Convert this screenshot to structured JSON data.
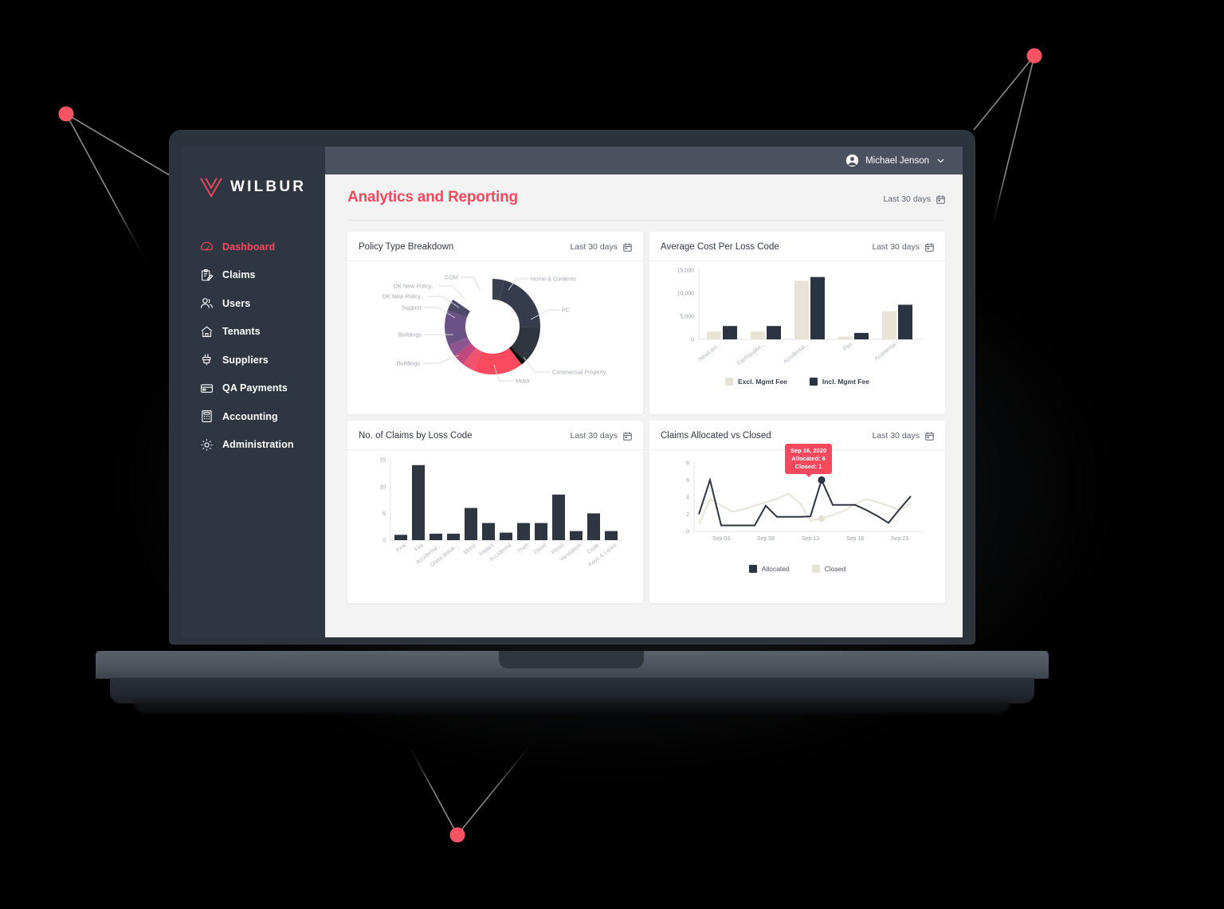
{
  "brand": {
    "name": "WILBUR",
    "logo_icon": "wilbur-logo-icon",
    "accent": "#f8485e"
  },
  "topbar": {
    "user_name": "Michael Jenson",
    "avatar_icon": "user-avatar-icon",
    "chevron_icon": "chevron-down-icon"
  },
  "sidebar": {
    "items": [
      {
        "label": "Dashboard",
        "icon": "gauge-icon",
        "active": true
      },
      {
        "label": "Claims",
        "icon": "clipboard-pen-icon",
        "active": false
      },
      {
        "label": "Users",
        "icon": "users-icon",
        "active": false
      },
      {
        "label": "Tenants",
        "icon": "home-icon",
        "active": false
      },
      {
        "label": "Suppliers",
        "icon": "paint-brush-icon",
        "active": false
      },
      {
        "label": "QA Payments",
        "icon": "credit-card-icon",
        "active": false
      },
      {
        "label": "Accounting",
        "icon": "calculator-icon",
        "active": false
      },
      {
        "label": "Administration",
        "icon": "gear-icon",
        "active": false
      }
    ]
  },
  "page": {
    "title": "Analytics and Reporting",
    "range_label": "Last 30 days",
    "calendar_icon": "calendar-icon"
  },
  "cards": {
    "policy_type": {
      "title": "Policy Type Breakdown",
      "range_label": "Last 30 days",
      "calendar_icon": "calendar-icon"
    },
    "avg_cost": {
      "title": "Average Cost Per Loss Code",
      "range_label": "Last 30 days",
      "calendar_icon": "calendar-icon"
    },
    "claims_count": {
      "title": "No. of Claims by Loss Code",
      "range_label": "Last 30 days",
      "calendar_icon": "calendar-icon"
    },
    "alloc_closed": {
      "title": "Claims Allocated vs Closed",
      "range_label": "Last 30 days",
      "calendar_icon": "calendar-icon"
    }
  },
  "chart_data": [
    {
      "id": "policy_type_breakdown",
      "type": "pie",
      "title": "Policy Type Breakdown",
      "donut": true,
      "legend_position": "outside-labels",
      "labels": [
        "Home & Contents",
        "PC",
        "Commercial Property",
        "Motor",
        "Buildings",
        "Buildings",
        "Support",
        "OK New Policy...",
        "OK New Policy...",
        "COM"
      ],
      "values": [
        4,
        21,
        13,
        1.5,
        17,
        4,
        4,
        4,
        12,
        4
      ],
      "colors": [
        "#39414f",
        "#343c4d",
        "#2f3640",
        "#0d0d0d",
        "#fa4a5f",
        "#f0536f",
        "#c0477f",
        "#8a5590",
        "#6a5186",
        "#4c4a66"
      ]
    },
    {
      "id": "average_cost_per_loss_code",
      "type": "bar",
      "title": "Average Cost Per Loss Code",
      "categories": [
        "NewLost...",
        "Earthquake...",
        "Accidental...",
        "Fire",
        "Accidental"
      ],
      "series": [
        {
          "name": "Excl. Mgmt Fee",
          "color": "#e8e4d5",
          "values": [
            1700,
            1700,
            12700,
            600,
            6100
          ]
        },
        {
          "name": "Incl. Mgmt Fee",
          "color": "#2b3442",
          "values": [
            2900,
            2900,
            13500,
            1400,
            7500
          ]
        }
      ],
      "ylabel": "",
      "xlabel": "",
      "yticks": [
        "0",
        "5,000",
        "10,000",
        "15,000"
      ],
      "ylim": [
        0,
        16500
      ],
      "grid": false
    },
    {
      "id": "no_of_claims_by_loss_code",
      "type": "bar",
      "title": "No. of Claims by Loss Code",
      "categories": [
        "First",
        "Fire",
        "Accidental...",
        "Glass break...",
        "Motor",
        "Impact",
        "Accidental",
        "Theft",
        "Flood",
        "Flood",
        "Vandalism",
        "Code",
        "Keys & Locks"
      ],
      "series": [
        {
          "name": "Claims",
          "color": "#2e3642",
          "values": [
            1,
            14,
            1.2,
            1.2,
            6,
            3.2,
            1.4,
            3.2,
            3.2,
            8.5,
            1.7,
            5,
            1.7
          ]
        }
      ],
      "yticks": [
        "0",
        "5",
        "10",
        "15"
      ],
      "ylim": [
        0,
        16
      ],
      "grid": false
    },
    {
      "id": "claims_allocated_vs_closed",
      "type": "line",
      "title": "Claims Allocated vs Closed",
      "x": [
        "Sep 01",
        "Sep 02",
        "Sep 03",
        "Sep 04",
        "Sep 05",
        "Sep 06",
        "Sep 07",
        "Sep 08",
        "Sep 09",
        "Sep 10",
        "Sep 11",
        "Sep 12",
        "Sep 13",
        "Sep 14",
        "Sep 15",
        "Sep 16",
        "Sep 17",
        "Sep 18",
        "Sep 19",
        "Sep 20",
        "Sep 21",
        "Sep 22",
        "Sep 23",
        "Sep 24",
        "Sep 25"
      ],
      "xticks": [
        "Sep 03",
        "Sep 08",
        "Sep 13",
        "Sep 18",
        "Sep 23"
      ],
      "yticks": [
        "0",
        "2",
        "4",
        "6",
        "8"
      ],
      "ylim": [
        0,
        9
      ],
      "series": [
        {
          "name": "Allocated",
          "color": "#2b3442",
          "values": [
            2,
            6,
            0.7,
            0.7,
            0.7,
            0.7,
            3,
            1.7,
            1.7,
            1.7,
            1.75,
            6,
            3.1,
            3.1,
            3.1,
            2.5,
            1.8,
            1,
            2.6,
            4.1
          ]
        },
        {
          "name": "Closed",
          "color": "#e8e4d5",
          "values": [
            0.8,
            3.8,
            3,
            2.3,
            2.6,
            3,
            3.4,
            3.8,
            4.4,
            3.4,
            1.3,
            1.5,
            1.9,
            2.4,
            3.2,
            3.8,
            3.4,
            3.0,
            2.5,
            3.3
          ]
        }
      ],
      "tooltip": {
        "date": "Sep 16, 2020",
        "allocated": "Allocated: 6",
        "closed": "Closed: 1"
      },
      "legend": [
        "Allocated",
        "Closed"
      ]
    }
  ]
}
